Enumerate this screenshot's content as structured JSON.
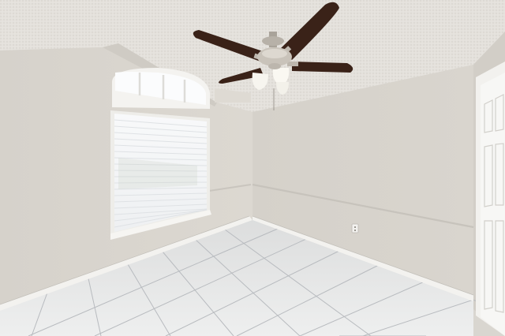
{
  "scene": {
    "subject": "empty-room-interior",
    "elements": [
      "ceiling-fan",
      "window-with-blinds",
      "arched-transom-window",
      "tile-floor",
      "closet-door",
      "chair-rail",
      "baseboard",
      "wall-outlet"
    ],
    "colors": {
      "ceiling": "#e6e3de",
      "wall_left": "#dcd8d2",
      "wall_back": "#d7d3cc",
      "floor": "#e9eaea",
      "grout": "#b9bcbf",
      "fan_blade": "#3a2218",
      "trim": "#f3f2ef",
      "window_light": "#f7f9fb"
    }
  }
}
